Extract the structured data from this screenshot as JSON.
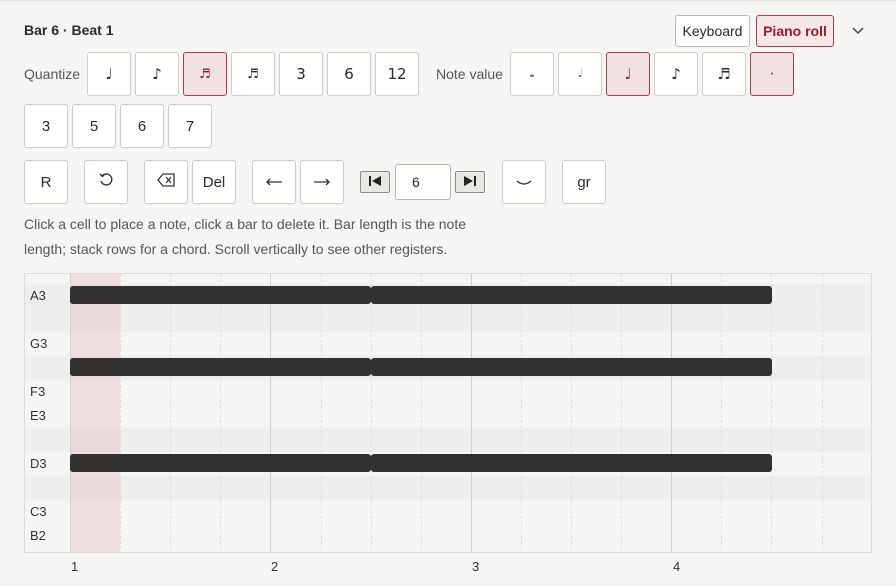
{
  "header": {
    "title": "Bar 6 · Beat 1",
    "keyboard_label": "Keyboard",
    "pianoroll_label": "Piano roll",
    "expand_icon": "chevron-down-icon"
  },
  "quantize": {
    "label": "Quantize",
    "options": [
      {
        "glyph": "♩",
        "icon": "quarter-note-icon",
        "active": false
      },
      {
        "glyph": "♪",
        "icon": "eighth-note-icon",
        "active": false
      },
      {
        "glyph": "♬",
        "icon": "sixteenth-note-icon",
        "active": true
      },
      {
        "glyph": "♬",
        "icon": "thirty-second-note-icon",
        "active": false
      },
      {
        "glyph": "3",
        "active": false
      },
      {
        "glyph": "6",
        "active": false
      },
      {
        "glyph": "12",
        "active": false
      }
    ]
  },
  "note_value": {
    "label": "Note value",
    "options": [
      {
        "glyph": "𝅝",
        "icon": "whole-note-icon",
        "active": false
      },
      {
        "glyph": "𝅗𝅥",
        "icon": "half-note-icon",
        "active": false
      },
      {
        "glyph": "♩",
        "icon": "quarter-note-icon",
        "active": true
      },
      {
        "glyph": "♪",
        "icon": "eighth-note-icon",
        "active": false
      },
      {
        "glyph": "♬",
        "icon": "sixteenth-note-icon",
        "active": false
      },
      {
        "glyph": "·",
        "icon": "dot-icon",
        "active": true
      }
    ],
    "tuplets": [
      "3",
      "5",
      "6",
      "7"
    ]
  },
  "toolbar": {
    "rest": "R",
    "undo_icon": "undo-icon",
    "backspace_icon": "backspace-icon",
    "del": "Del",
    "left_icon": "arrow-left-icon",
    "right_icon": "arrow-right-icon",
    "prev_bar_icon": "skip-back-icon",
    "bar_number": "6",
    "next_bar_icon": "skip-forward-icon",
    "tie_icon": "tie-icon",
    "grace": "gr"
  },
  "help": {
    "line1": "Click a cell to place a note, click a bar to delete it. Bar length is the note",
    "line2": "length; stack rows for a chord. Scroll vertically to see other registers."
  },
  "roll": {
    "row_labels": [
      "A3",
      "G3",
      "F3",
      "E3",
      "D3",
      "C3",
      "B2"
    ],
    "bar_numbers": [
      "1",
      "2",
      "3",
      "4"
    ]
  },
  "colors": {
    "accent": "#b33a4a",
    "note": "#333130",
    "playhead": "#e8d3d6"
  }
}
